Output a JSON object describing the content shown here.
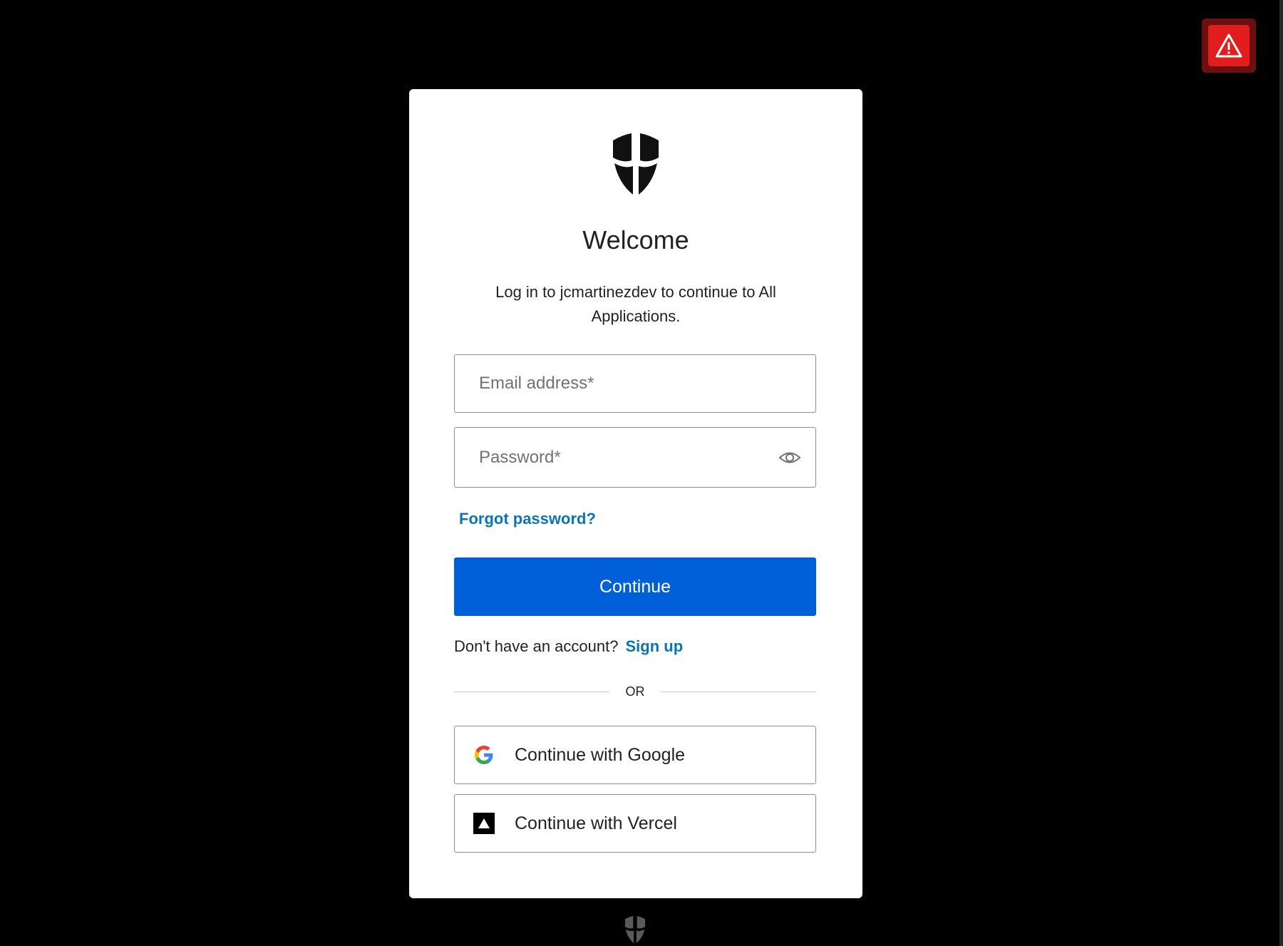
{
  "colors": {
    "background": "#000000",
    "card": "#ffffff",
    "primary": "#0160d9",
    "link": "#0a75b5",
    "warning": "#e21d1d"
  },
  "toolbar": {
    "warning_icon": "warning-triangle-icon"
  },
  "login": {
    "logo_icon": "shield-logo-icon",
    "title": "Welcome",
    "subtitle": "Log in to jcmartinezdev to continue to All Applications.",
    "email": {
      "placeholder": "Email address*",
      "value": ""
    },
    "password": {
      "placeholder": "Password*",
      "value": "",
      "toggle_icon": "eye-icon"
    },
    "forgot_password": "Forgot password?",
    "continue_label": "Continue",
    "signup_prompt": "Don't have an account?",
    "signup_link": "Sign up",
    "divider": "OR",
    "social": [
      {
        "label": "Continue with Google",
        "icon": "google-icon"
      },
      {
        "label": "Continue with Vercel",
        "icon": "vercel-icon"
      }
    ]
  },
  "footer": {
    "logo_icon": "shield-logo-icon"
  }
}
